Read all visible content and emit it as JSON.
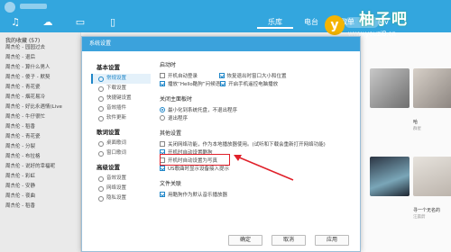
{
  "app": {
    "tabs": [
      "乐库",
      "电台",
      "歌单",
      "MV"
    ],
    "sidebar_header": "我的收藏",
    "sidebar_header_count": "(57)",
    "sidebar_items": [
      "周杰伦 - 园园过去",
      "周杰伦 - 退后",
      "周杰伦 - 算什么男人",
      "周杰伦 - 傻子 - 默契",
      "周杰伦 - 青花瓷",
      "周杰伦 - 烟花易冷",
      "周杰伦 - 好比永遇情(Live",
      "周杰伦 - 牛仔很忙",
      "周杰伦 - 稻香",
      "周杰伦 - 青花瓷",
      "周杰伦 - 分裂",
      "周杰伦 - 布拉格",
      "周杰伦 - 说好的幸福呢",
      "周杰伦 - 彩虹",
      "周杰伦 - 安静",
      "周杰伦 - 夜曲",
      "周杰伦 - 稻香"
    ],
    "cards": [
      {
        "title": "哈",
        "sub": "群星"
      },
      {
        "title": "寻一个无名的",
        "sub": "汪晨蔚"
      }
    ]
  },
  "watermark": {
    "letter": "y",
    "title": "柚子吧",
    "url": "www.youzi8.cn"
  },
  "dialog": {
    "title": "系统设置",
    "nav": [
      {
        "group": "基本设置",
        "items": [
          {
            "label": "常规设置",
            "icon": "gear-icon",
            "active": true
          },
          {
            "label": "下载设置",
            "icon": "download-icon",
            "active": false
          },
          {
            "label": "快捷键设置",
            "icon": "keyboard-icon",
            "active": false
          },
          {
            "label": "音效插件",
            "icon": "equalizer-icon",
            "active": false
          },
          {
            "label": "软件更新",
            "icon": "refresh-icon",
            "active": false
          }
        ]
      },
      {
        "group": "歌词设置",
        "items": [
          {
            "label": "桌面歌词",
            "icon": "lyrics-icon",
            "active": false
          },
          {
            "label": "窗口歌词",
            "icon": "window-icon",
            "active": false
          }
        ]
      },
      {
        "group": "高级设置",
        "items": [
          {
            "label": "音效设置",
            "icon": "sound-icon",
            "active": false
          },
          {
            "label": "网络设置",
            "icon": "network-icon",
            "active": false
          },
          {
            "label": "隐私设置",
            "icon": "privacy-icon",
            "active": false
          }
        ]
      }
    ],
    "sections": {
      "startup": {
        "title": "启动时",
        "options": [
          {
            "label": "开机自动登录",
            "checked": false
          },
          {
            "label": "恢复退出时窗口大小和位置",
            "checked": true
          },
          {
            "label": "播放“Hello酷狗”问候语",
            "checked": true
          },
          {
            "label": "开启手机遥控电脑播放",
            "checked": true
          }
        ]
      },
      "close": {
        "title": "关闭主面板时",
        "options": [
          {
            "label": "最小化到系统托盘，不退出程序",
            "checked": true
          },
          {
            "label": "退出程序",
            "checked": false
          }
        ]
      },
      "other": {
        "title": "其他设置",
        "options": [
          {
            "label": "关闭网络功能，作为本地播放器使用。(试听和下载会重新打开网络功能)",
            "checked": false
          },
          {
            "label": "开机时自动设置酷狗",
            "checked": true
          },
          {
            "label": "开机时自动设置为写真",
            "checked": false
          },
          {
            "label": "US歌曲时显示设备接入提示",
            "checked": true
          }
        ]
      },
      "fileassoc": {
        "title": "文件关联",
        "options": [
          {
            "label": "用酷狗作为默认音乐播放器",
            "checked": true
          }
        ]
      }
    },
    "buttons": {
      "ok": "确定",
      "cancel": "取消",
      "apply": "应用"
    }
  }
}
